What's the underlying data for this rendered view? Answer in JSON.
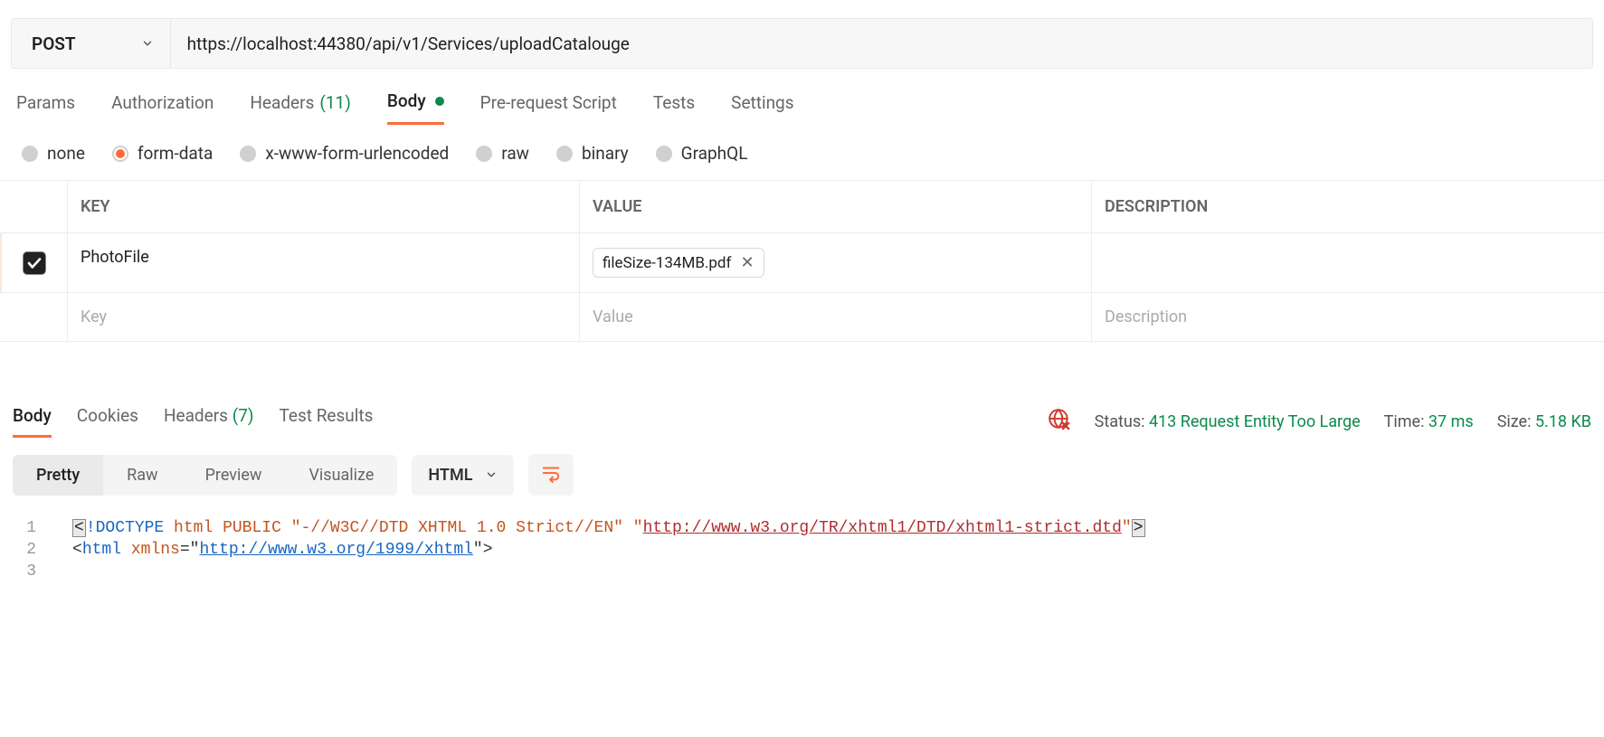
{
  "request": {
    "method": "POST",
    "url": "https://localhost:44380/api/v1/Services/uploadCatalouge"
  },
  "tabs": {
    "params": "Params",
    "authorization": "Authorization",
    "headers_label": "Headers",
    "headers_count": "(11)",
    "body": "Body",
    "prerequest": "Pre-request Script",
    "tests": "Tests",
    "settings": "Settings"
  },
  "body_types": {
    "none": "none",
    "form_data": "form-data",
    "urlencoded": "x-www-form-urlencoded",
    "raw": "raw",
    "binary": "binary",
    "graphql": "GraphQL"
  },
  "kv": {
    "header_key": "KEY",
    "header_value": "VALUE",
    "header_desc": "DESCRIPTION",
    "rows": [
      {
        "key": "PhotoFile",
        "file": "fileSize-134MB.pdf"
      }
    ],
    "placeholder_key": "Key",
    "placeholder_value": "Value",
    "placeholder_desc": "Description"
  },
  "response": {
    "tabs": {
      "body": "Body",
      "cookies": "Cookies",
      "headers_label": "Headers",
      "headers_count": "(7)",
      "test_results": "Test Results"
    },
    "meta": {
      "status_label": "Status:",
      "status_value": "413 Request Entity Too Large",
      "time_label": "Time:",
      "time_value": "37 ms",
      "size_label": "Size:",
      "size_value": "5.18 KB"
    },
    "view_tabs": {
      "pretty": "Pretty",
      "raw": "Raw",
      "preview": "Preview",
      "visualize": "Visualize"
    },
    "format": "HTML",
    "code": {
      "l1a": "!DOCTYPE",
      "l1b": "html",
      "l1c": "PUBLIC",
      "l1d": "\"-//W3C//DTD XHTML 1.0 Strict//EN\"",
      "l1e": "\"",
      "l1f": "http://www.w3.org/TR/xhtml1/DTD/xhtml1-strict.dtd",
      "l1g": "\"",
      "l2a": "html",
      "l2b": "xmlns",
      "l2c": "=\"",
      "l2d": "http://www.w3.org/1999/xhtml",
      "l2e": "\">",
      "ln1": "1",
      "ln2": "2",
      "ln3": "3"
    }
  }
}
